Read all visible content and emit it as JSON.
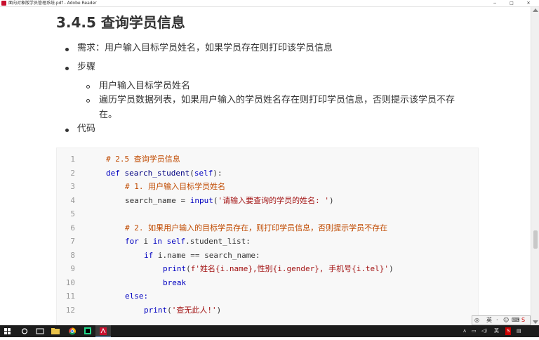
{
  "window": {
    "title": "面向对象版学员管理系统.pdf - Adobe Reader",
    "controls": [
      "−",
      "□",
      "✕"
    ]
  },
  "document": {
    "section_title": "3.4.5 查询学员信息",
    "bullets": [
      "需求：用户输入目标学员姓名，如果学员存在则打印该学员信息",
      "步骤",
      "代码"
    ],
    "sub_bullets": [
      "用户输入目标学员姓名",
      "遍历学员数据列表，如果用户输入的学员姓名存在则打印学员信息，否则提示该学员不存",
      "在。"
    ],
    "code": {
      "line_numbers": [
        "1",
        "2",
        "3",
        "4",
        "5",
        "6",
        "7",
        "8",
        "9",
        "10",
        "11",
        "12"
      ],
      "l1": "# 2.5 查询学员信息",
      "l2_kw": "def",
      "l2_fn": " search_student",
      "l2_p1": "(",
      "l2_self": "self",
      "l2_p2": "):",
      "l3": "# 1. 用户输入目标学员姓名",
      "l4_a": "search_name = ",
      "l4_fn": "input",
      "l4_b": "(",
      "l4_str": "'请输入要查询的学员的姓名: '",
      "l4_c": ")",
      "l6": "# 2. 如果用户输入的目标学员存在，则打印学员信息，否则提示学员不存在",
      "l7_for": "for",
      "l7_a": " i ",
      "l7_in": "in",
      "l7_self": " self",
      "l7_b": ".student_list:",
      "l8_if": "if",
      "l8_a": " i.name == search_name:",
      "l9_print": "print",
      "l9_a": "(",
      "l9_str": "f'姓名{i.name},性别{i.gender}, 手机号{i.tel}'",
      "l9_b": ")",
      "l10": "break",
      "l11": "else:",
      "l12_print": "print",
      "l12_a": "(",
      "l12_str": "'查无此人!'",
      "l12_b": ")"
    }
  },
  "ime": {
    "lang": "英",
    "mode": "·",
    "s": "S"
  },
  "taskbar": {
    "tray_lang": "英",
    "tray_badge": "S"
  }
}
